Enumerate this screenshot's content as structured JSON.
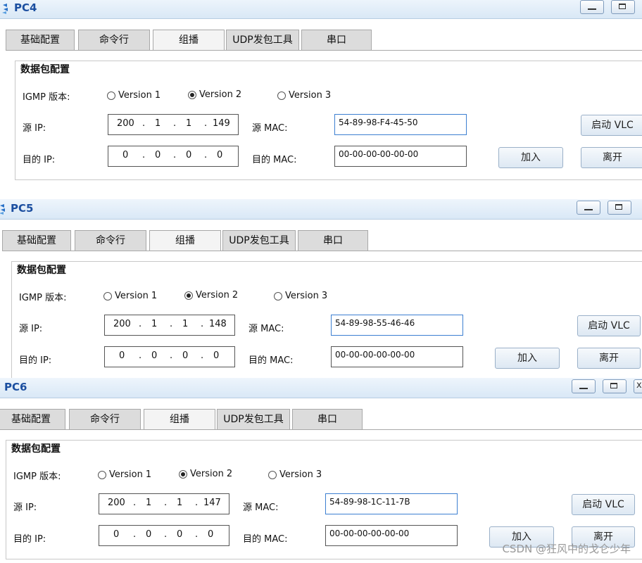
{
  "tabs": [
    "基础配置",
    "命令行",
    "组播",
    "UDP发包工具",
    "串口"
  ],
  "section_title": "数据包配置",
  "igmp_label": "IGMP 版本:",
  "versions": [
    "Version 1",
    "Version 2",
    "Version 3"
  ],
  "selected_version": "Version 2",
  "src_ip_label": "源 IP:",
  "dst_ip_label": "目的 IP:",
  "src_mac_label": "源  MAC:",
  "dst_mac_label": "目的 MAC:",
  "buttons": {
    "vlc": "启动 VLC",
    "join": "加入",
    "leave": "离开"
  },
  "window_controls": {
    "minimize": "—",
    "maximize": "□",
    "close": "x"
  },
  "windows": [
    {
      "title": "PC4",
      "src_ip": [
        "200",
        "1",
        "1",
        "149"
      ],
      "dst_ip": [
        "0",
        "0",
        "0",
        "0"
      ],
      "src_mac": "54-89-98-F4-45-50",
      "dst_mac": "00-00-00-00-00-00"
    },
    {
      "title": "PC5",
      "src_ip": [
        "200",
        "1",
        "1",
        "148"
      ],
      "dst_ip": [
        "0",
        "0",
        "0",
        "0"
      ],
      "src_mac": "54-89-98-55-46-46",
      "dst_mac": "00-00-00-00-00-00"
    },
    {
      "title": "PC6",
      "src_ip": [
        "200",
        "1",
        "1",
        "147"
      ],
      "dst_ip": [
        "0",
        "0",
        "0",
        "0"
      ],
      "src_mac": "54-89-98-1C-11-7B",
      "dst_mac": "00-00-00-00-00-00"
    }
  ],
  "watermark": "CSDN @狂风中的戈仑少年",
  "colors": {
    "title_text": "#1c4fa0",
    "titlebar": "#d9e8f6",
    "focus_border": "#3c7fd1"
  }
}
